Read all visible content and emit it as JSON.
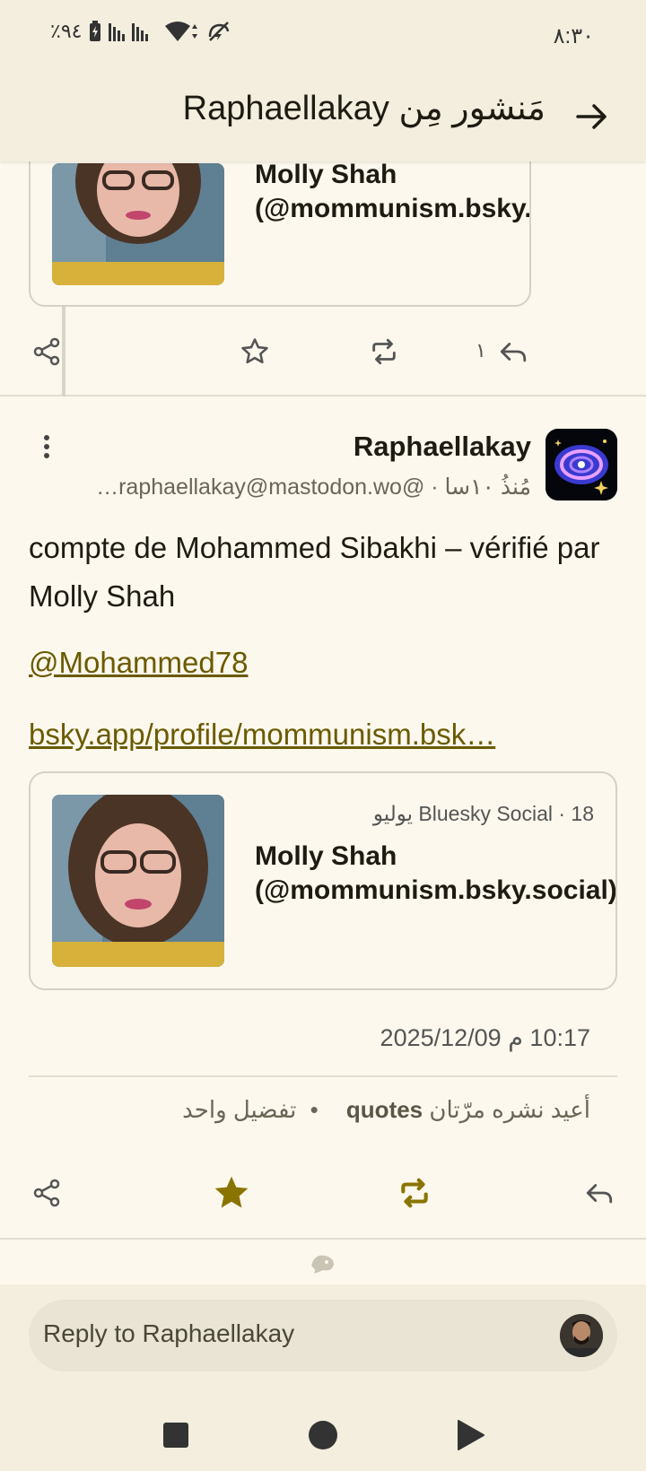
{
  "status_bar": {
    "battery": "٪٩٤",
    "time": "٨:٣٠"
  },
  "app_bar": {
    "title": "مَنشور مِن Raphaellakay",
    "back_icon": "arrow-right-icon"
  },
  "previous_post": {
    "card_title": "Molly Shah (@mommunism.bsky.social)",
    "reply_count": "١"
  },
  "post": {
    "author_name": "Raphaellakay",
    "author_meta": "مُنذُ ١٠سا · @raphaellakay@mastodon.wo…",
    "text": "compte de Mohammed Sibakhi – vérifié par Molly Shah",
    "mention": "@Mohammed78",
    "link": "bsky.app/profile/mommunism.bsk…",
    "link_card": {
      "source": "Bluesky Social · 18 يوليو",
      "title": "Molly Shah (@mommunism.bsky.social)"
    },
    "timestamp": "10:17 م 2025/12/09",
    "stats": {
      "reblogs": "أعيد نشره مرّتان",
      "quotes": "quotes",
      "favourites": "تفضيل واحد"
    }
  },
  "composer": {
    "placeholder": "Reply to Raphaellakay"
  },
  "colors": {
    "background": "#fcf8ed",
    "bar": "#f3eedd",
    "accent": "#8a7400",
    "link": "#6b5a00"
  }
}
